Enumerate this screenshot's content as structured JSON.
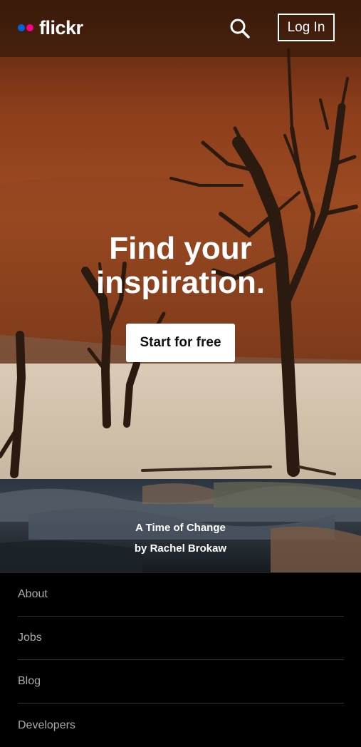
{
  "header": {
    "logo_text": "flickr",
    "login_label": "Log In",
    "search_icon": "search-icon"
  },
  "hero": {
    "headline_line1": "Find your",
    "headline_line2": "inspiration.",
    "cta_label": "Start for free"
  },
  "photo_credit": {
    "title": "A Time of Change",
    "author": "by Rachel Brokaw"
  },
  "footer": {
    "items": [
      {
        "label": "About"
      },
      {
        "label": "Jobs"
      },
      {
        "label": "Blog"
      },
      {
        "label": "Developers"
      }
    ]
  },
  "colors": {
    "brand_blue": "#0063dc",
    "brand_pink": "#ff0084"
  }
}
